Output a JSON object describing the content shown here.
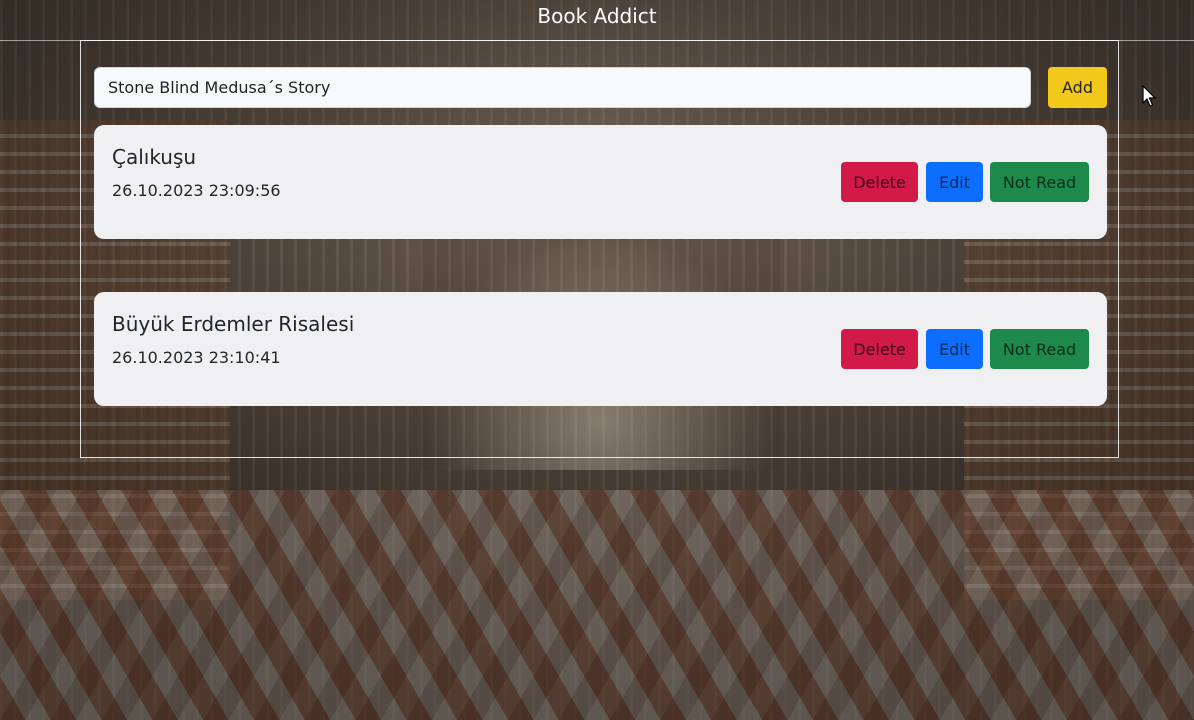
{
  "header": {
    "title": "Book Addict"
  },
  "form": {
    "input_value": "Stone Blind Medusa´s Story",
    "add_label": "Add"
  },
  "books": [
    {
      "title": "Çalıkuşu",
      "date": "26.10.2023 23:09:56",
      "delete_label": "Delete",
      "edit_label": "Edit",
      "status_label": "Not Read"
    },
    {
      "title": "Büyük Erdemler Risalesi",
      "date": "26.10.2023 23:10:41",
      "delete_label": "Delete",
      "edit_label": "Edit",
      "status_label": "Not Read"
    }
  ],
  "colors": {
    "add": "#f2c81a",
    "delete": "#d11a47",
    "edit": "#0d6efd",
    "not_read": "#1d8a4c",
    "card": "#f0f0f3"
  }
}
